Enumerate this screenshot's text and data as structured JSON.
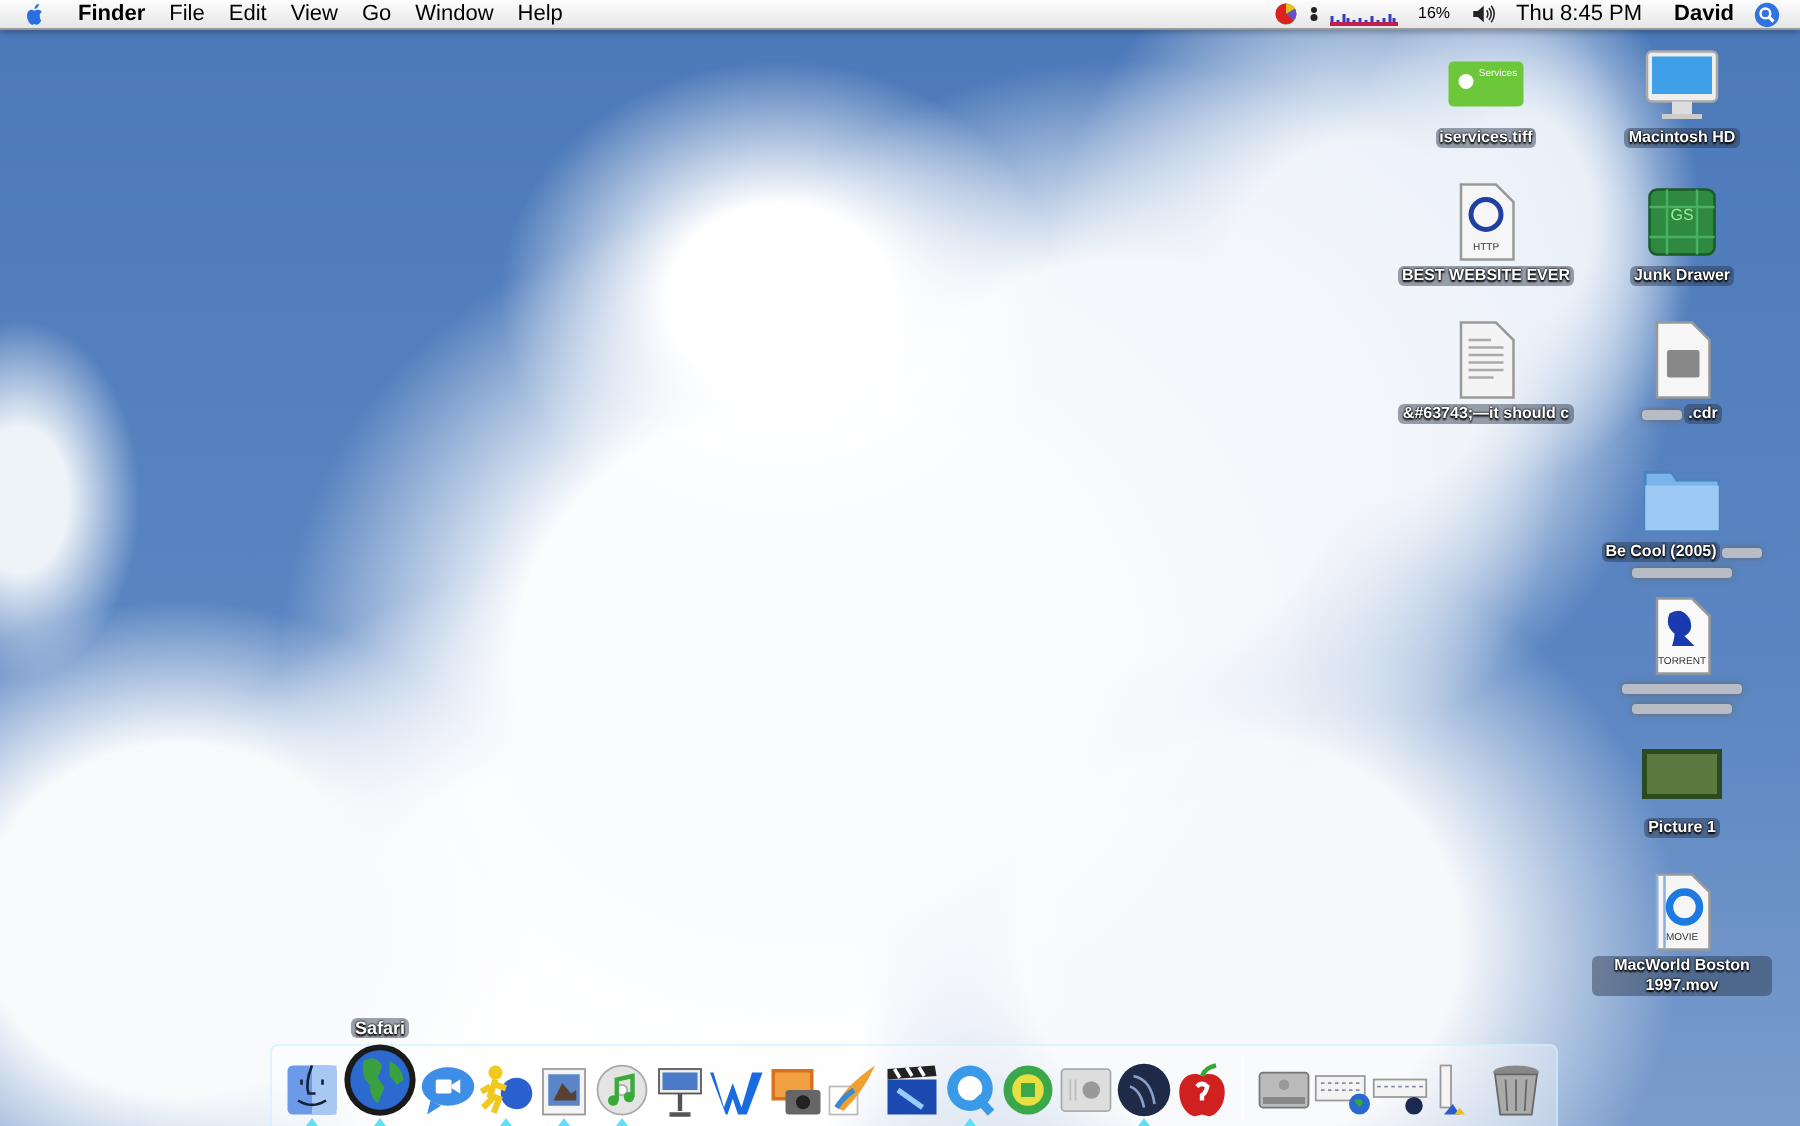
{
  "menu_bar": {
    "app_name": "Finder",
    "menus": [
      "File",
      "Edit",
      "View",
      "Go",
      "Window",
      "Help"
    ],
    "status": {
      "battery": "16%",
      "clock": "Thu 8:45 PM",
      "user": "David"
    }
  },
  "desktop": {
    "column_1": [
      {
        "kind": "card",
        "label": "iservices.tiff",
        "badge": "Services",
        "obscured": false
      },
      {
        "kind": "web-document",
        "label": "BEST WEBSITE EVER",
        "badge": "HTTP",
        "obscured": false
      },
      {
        "kind": "text-document",
        "label": "&#63743;—it should c",
        "obscured": false
      }
    ],
    "column_2": [
      {
        "kind": "monitor",
        "label": "Macintosh HD",
        "obscured": false
      },
      {
        "kind": "cube",
        "label": "Junk Drawer",
        "badge": "GS",
        "obscured": false
      },
      {
        "kind": "disk-document",
        "label": ".cdr",
        "obscured": true
      },
      {
        "kind": "folder",
        "label": "Be Cool (2005)",
        "obscured": true
      },
      {
        "kind": "torrent-document",
        "badge": "TORRENT",
        "obscured": true
      },
      {
        "kind": "photo",
        "label": "Picture 1",
        "obscured": false
      },
      {
        "kind": "movie-document",
        "label": "MacWorld Boston 1997.mov",
        "badge": "MOVIE",
        "obscured": false
      }
    ]
  },
  "dock": {
    "tooltip": "Safari",
    "items": [
      {
        "kind": "finder",
        "running": true,
        "hovered": false
      },
      {
        "kind": "globe",
        "running": true,
        "hovered": true
      },
      {
        "kind": "chat",
        "running": false,
        "hovered": false
      },
      {
        "kind": "figure",
        "running": true,
        "hovered": false
      },
      {
        "kind": "preview",
        "running": true,
        "hovered": false
      },
      {
        "kind": "music",
        "running": true,
        "hovered": false
      },
      {
        "kind": "podium",
        "running": false,
        "hovered": false
      },
      {
        "kind": "wave",
        "running": false,
        "hovered": false
      },
      {
        "kind": "camera",
        "running": false,
        "hovered": false
      },
      {
        "kind": "brush",
        "running": false,
        "hovered": false
      },
      {
        "kind": "clapper",
        "running": false,
        "hovered": false
      },
      {
        "kind": "ring",
        "running": true,
        "hovered": false
      },
      {
        "kind": "gear",
        "running": false,
        "hovered": false
      },
      {
        "kind": "box",
        "running": false,
        "hovered": false
      },
      {
        "kind": "sphere",
        "running": true,
        "hovered": false
      },
      {
        "kind": "apple",
        "running": false,
        "hovered": false
      },
      {
        "kind": "separator"
      },
      {
        "kind": "drive",
        "running": false,
        "hovered": false
      },
      {
        "kind": "window",
        "running": false,
        "hovered": false
      },
      {
        "kind": "window2",
        "running": false,
        "hovered": false
      },
      {
        "kind": "document",
        "running": false,
        "hovered": false
      },
      {
        "kind": "trash",
        "running": false,
        "hovered": false
      }
    ]
  }
}
